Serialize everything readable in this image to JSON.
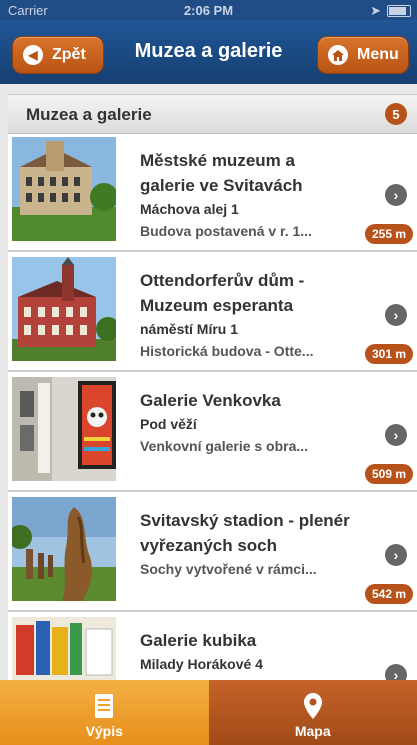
{
  "status": {
    "carrier": "Carrier",
    "time": "2:06 PM"
  },
  "nav": {
    "back_label": "Zpět",
    "title": "Muzea a galerie",
    "menu_label": "Menu"
  },
  "section": {
    "title": "Muzea a galerie",
    "count": "5"
  },
  "items": [
    {
      "name": "Městské muzeum a galerie ve Svitavách",
      "address": "Máchova alej 1",
      "description": "Budova postavená v r. 1...",
      "distance": "255 m"
    },
    {
      "name": "Ottendorferův dům - Muzeum esperanta",
      "address": "náměstí Míru 1",
      "description": "Historická budova - Otte...",
      "distance": "301 m"
    },
    {
      "name": "Galerie Venkovka",
      "address": "Pod věží",
      "description": "Venkovní galerie s obra...",
      "distance": "509 m"
    },
    {
      "name": "Svitavský stadion - plenér vyřezaných soch",
      "address": "",
      "description": "Sochy vytvořené v rámci...",
      "distance": "542 m"
    },
    {
      "name": "Galerie kubika",
      "address": "Milady Horákové 4",
      "description": "",
      "distance": ""
    }
  ],
  "tabs": {
    "list_label": "Výpis",
    "map_label": "Mapa"
  },
  "colors": {
    "nav_bg": "#1f5696",
    "accent": "#b7531a",
    "tab_active": "#f0a030"
  }
}
